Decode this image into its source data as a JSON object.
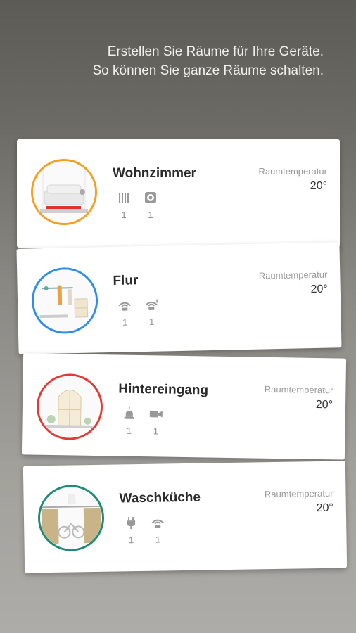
{
  "intro": {
    "line1": "Erstellen Sie Räume für Ihre Geräte.",
    "line2": "So können Sie ganze Räume schalten."
  },
  "rooms": [
    {
      "name": "Wohnzimmer",
      "accent": "#f5a023",
      "temp_label": "Raumtemperatur",
      "temp_value": "20°",
      "devices": [
        {
          "icon": "radiator-icon",
          "count": "1"
        },
        {
          "icon": "thermostat-icon",
          "count": "1"
        }
      ]
    },
    {
      "name": "Flur",
      "accent": "#2f8ee8",
      "temp_label": "Raumtemperatur",
      "temp_value": "20°",
      "devices": [
        {
          "icon": "motion-sensor-icon",
          "count": "1"
        },
        {
          "icon": "motion-sensor-alt-icon",
          "count": "1"
        }
      ]
    },
    {
      "name": "Hintereingang",
      "accent": "#e53935",
      "temp_label": "Raumtemperatur",
      "temp_value": "20°",
      "devices": [
        {
          "icon": "alarm-siren-icon",
          "count": "1"
        },
        {
          "icon": "video-camera-icon",
          "count": "1"
        }
      ]
    },
    {
      "name": "Waschküche",
      "accent": "#1e8c74",
      "temp_label": "Raumtemperatur",
      "temp_value": "20°",
      "devices": [
        {
          "icon": "plug-icon",
          "count": "1"
        },
        {
          "icon": "motion-sensor-icon",
          "count": "1"
        }
      ]
    }
  ]
}
